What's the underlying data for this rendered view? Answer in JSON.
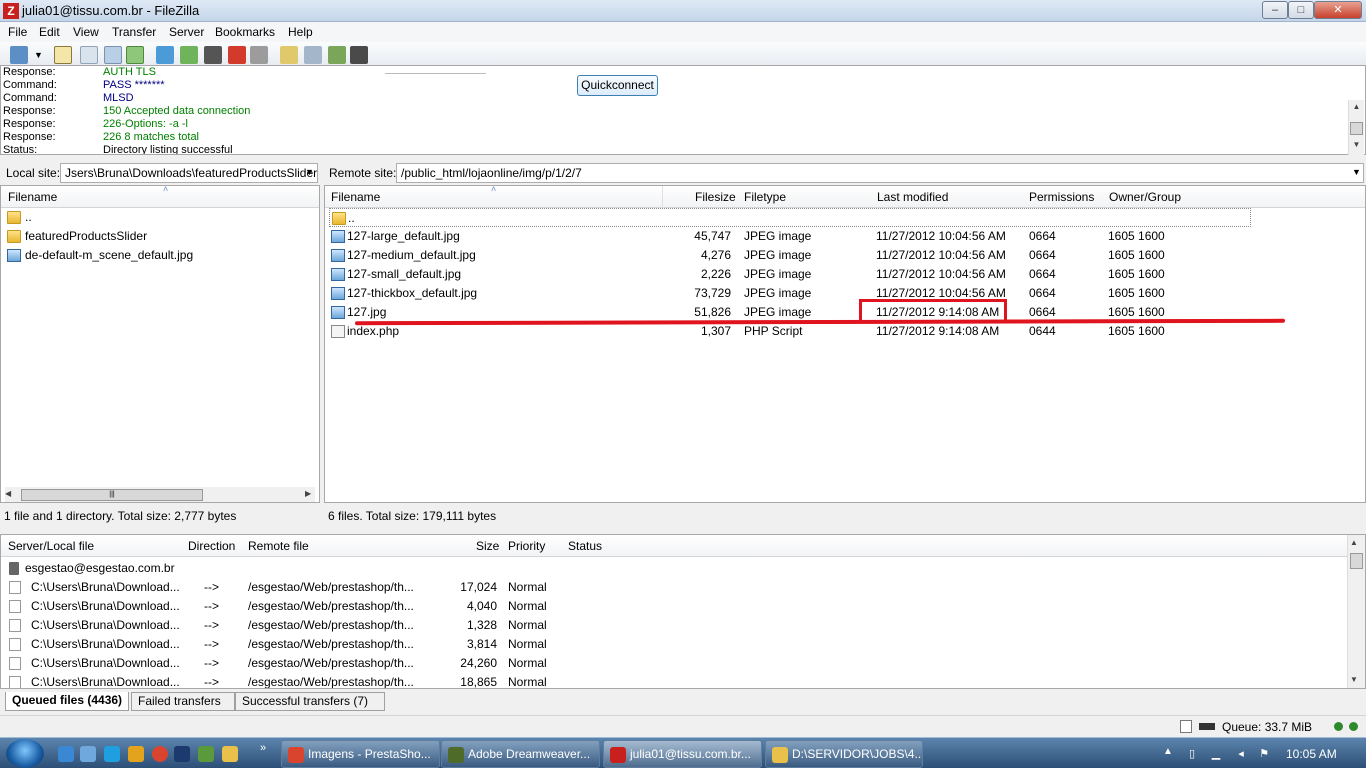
{
  "window": {
    "title": "julia01@tissu.com.br - FileZilla",
    "app_icon": "Z"
  },
  "menu": [
    "File",
    "Edit",
    "View",
    "Transfer",
    "Server",
    "Bookmarks",
    "Help"
  ],
  "quickconnect_label": "Quickconnect",
  "log": [
    {
      "label": "Response:",
      "text": "AUTH TLS",
      "color": "#008000"
    },
    {
      "label": "Command:",
      "text": "PASS *******",
      "color": "#000080"
    },
    {
      "label": "Command:",
      "text": "MLSD",
      "color": "#000080"
    },
    {
      "label": "Response:",
      "text": "150 Accepted data connection",
      "color": "#008000"
    },
    {
      "label": "Response:",
      "text": "226-Options: -a -l",
      "color": "#008000"
    },
    {
      "label": "Response:",
      "text": "226 8 matches total",
      "color": "#008000"
    },
    {
      "label": "Status:",
      "text": "Directory listing successful",
      "color": "#000000"
    }
  ],
  "local": {
    "site_label": "Local site:",
    "path": "Jsers\\Bruna\\Downloads\\featuredProductsSlider\\",
    "col_filename": "Filename",
    "files": [
      "..",
      "featuredProductsSlider",
      "de-default-m_scene_default.jpg"
    ],
    "status": "1 file and 1 directory. Total size: 2,777 bytes"
  },
  "remote": {
    "site_label": "Remote site:",
    "path": "/public_html/lojaonline/img/p/1/2/7",
    "columns": {
      "filename": "Filename",
      "filesize": "Filesize",
      "filetype": "Filetype",
      "modified": "Last modified",
      "permissions": "Permissions",
      "owner": "Owner/Group"
    },
    "parent": "..",
    "files": [
      {
        "name": "127-large_default.jpg",
        "size": "45,747",
        "type": "JPEG image",
        "modified": "11/27/2012 10:04:56 AM",
        "perm": "0664",
        "owner": "1605 1600"
      },
      {
        "name": "127-medium_default.jpg",
        "size": "4,276",
        "type": "JPEG image",
        "modified": "11/27/2012 10:04:56 AM",
        "perm": "0664",
        "owner": "1605 1600"
      },
      {
        "name": "127-small_default.jpg",
        "size": "2,226",
        "type": "JPEG image",
        "modified": "11/27/2012 10:04:56 AM",
        "perm": "0664",
        "owner": "1605 1600"
      },
      {
        "name": "127-thickbox_default.jpg",
        "size": "73,729",
        "type": "JPEG image",
        "modified": "11/27/2012 10:04:56 AM",
        "perm": "0664",
        "owner": "1605 1600"
      },
      {
        "name": "127.jpg",
        "size": "51,826",
        "type": "JPEG image",
        "modified": "11/27/2012 9:14:08 AM",
        "perm": "0664",
        "owner": "1605 1600"
      },
      {
        "name": "index.php",
        "size": "1,307",
        "type": "PHP Script",
        "modified": "11/27/2012 9:14:08 AM",
        "perm": "0644",
        "owner": "1605 1600"
      }
    ],
    "status": "6 files. Total size: 179,111 bytes"
  },
  "queue": {
    "columns": {
      "server": "Server/Local file",
      "direction": "Direction",
      "remote": "Remote file",
      "size": "Size",
      "priority": "Priority",
      "status": "Status"
    },
    "server": "esgestao@esgestao.com.br",
    "rows": [
      {
        "local": "C:\\Users\\Bruna\\Download...",
        "dir": "-->",
        "remote": "/esgestao/Web/prestashop/th...",
        "size": "17,024",
        "priority": "Normal"
      },
      {
        "local": "C:\\Users\\Bruna\\Download...",
        "dir": "-->",
        "remote": "/esgestao/Web/prestashop/th...",
        "size": "4,040",
        "priority": "Normal"
      },
      {
        "local": "C:\\Users\\Bruna\\Download...",
        "dir": "-->",
        "remote": "/esgestao/Web/prestashop/th...",
        "size": "1,328",
        "priority": "Normal"
      },
      {
        "local": "C:\\Users\\Bruna\\Download...",
        "dir": "-->",
        "remote": "/esgestao/Web/prestashop/th...",
        "size": "3,814",
        "priority": "Normal"
      },
      {
        "local": "C:\\Users\\Bruna\\Download...",
        "dir": "-->",
        "remote": "/esgestao/Web/prestashop/th...",
        "size": "24,260",
        "priority": "Normal"
      },
      {
        "local": "C:\\Users\\Bruna\\Download...",
        "dir": "-->",
        "remote": "/esgestao/Web/prestashop/th...",
        "size": "18,865",
        "priority": "Normal"
      }
    ],
    "tabs": [
      "Queued files (4436)",
      "Failed transfers",
      "Successful transfers (7)"
    ]
  },
  "statusbar": {
    "queue": "Queue: 33.7 MiB"
  },
  "taskbar": {
    "tasks": [
      {
        "label": "Imagens - PrestaSho...",
        "icon_color": "#d9442e",
        "icon": "chrome-icon"
      },
      {
        "label": "Adobe Dreamweaver...",
        "icon_color": "#4f6b2a",
        "icon": "dreamweaver-icon"
      },
      {
        "label": "julia01@tissu.com.br...",
        "icon_color": "#c8201c",
        "icon": "filezilla-icon"
      },
      {
        "label": "D:\\SERVIDOR\\JOBS\\4...",
        "icon_color": "#e8c04a",
        "icon": "folder-icon"
      }
    ],
    "clock": "10:05 AM"
  },
  "colors": {
    "annotation_red": "#e0141e",
    "selection_border": "#8a8a8a"
  }
}
